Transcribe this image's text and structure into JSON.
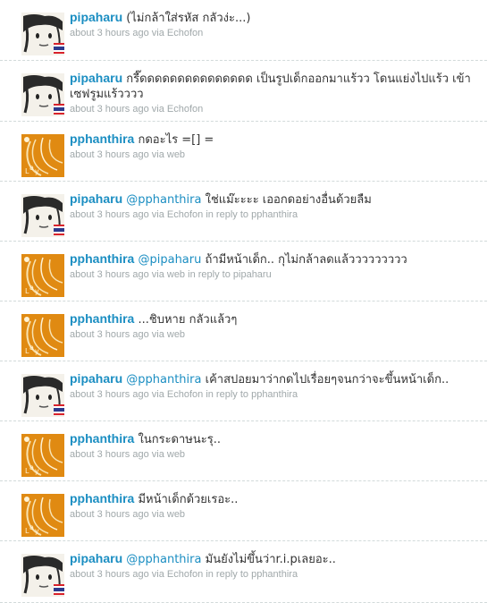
{
  "tweets": [
    {
      "user": "pipaharu",
      "avatar": "pipaharu-avatar",
      "mention": "",
      "text": "(ไม่กล้าใส่รหัส กลัวง่ะ...)",
      "time": "about 3 hours ago",
      "via_prefix": "via",
      "source": "Echofon",
      "reply_prefix": "",
      "reply_to": ""
    },
    {
      "user": "pipaharu",
      "avatar": "pipaharu-avatar",
      "mention": "",
      "text": "กรี๊ดดดดดดดดดดดดดดด เป็นรูปเด็กออกมาแร้วว โดนแย่งไปแร้ว เข้าเซฟรูมแร้วววว",
      "time": "about 3 hours ago",
      "via_prefix": "via",
      "source": "Echofon",
      "reply_prefix": "",
      "reply_to": ""
    },
    {
      "user": "pphanthira",
      "avatar": "pphanthira-avatar",
      "mention": "",
      "text": "กดอะไร =[] =",
      "time": "about 3 hours ago",
      "via_prefix": "via",
      "source": "web",
      "reply_prefix": "",
      "reply_to": ""
    },
    {
      "user": "pipaharu",
      "avatar": "pipaharu-avatar",
      "mention": "@pphanthira",
      "text": "ใช่แม๊ะะะะ เออกดอย่างอื่นด้วยลืม",
      "time": "about 3 hours ago",
      "via_prefix": "via",
      "source": "Echofon",
      "reply_prefix": "in reply to",
      "reply_to": "pphanthira"
    },
    {
      "user": "pphanthira",
      "avatar": "pphanthira-avatar",
      "mention": "@pipaharu",
      "text": "ถ้ามีหน้าเด็ก.. กุไม่กล้าลดแล้ววววววววว",
      "time": "about 3 hours ago",
      "via_prefix": "via",
      "source": "web",
      "reply_prefix": "in reply to",
      "reply_to": "pipaharu"
    },
    {
      "user": "pphanthira",
      "avatar": "pphanthira-avatar",
      "mention": "",
      "text": "...ชิบหาย กลัวแล้วๆ",
      "time": "about 3 hours ago",
      "via_prefix": "via",
      "source": "web",
      "reply_prefix": "",
      "reply_to": ""
    },
    {
      "user": "pipaharu",
      "avatar": "pipaharu-avatar",
      "mention": "@pphanthira",
      "text": "เค้าสปอยมาว่ากดไปเรื่อยๆจนกว่าจะขึ้นหน้าเด็ก..",
      "time": "about 3 hours ago",
      "via_prefix": "via",
      "source": "Echofon",
      "reply_prefix": "in reply to",
      "reply_to": "pphanthira"
    },
    {
      "user": "pphanthira",
      "avatar": "pphanthira-avatar",
      "mention": "",
      "text": "ในกระดาษนะรุ..",
      "time": "about 3 hours ago",
      "via_prefix": "via",
      "source": "web",
      "reply_prefix": "",
      "reply_to": ""
    },
    {
      "user": "pphanthira",
      "avatar": "pphanthira-avatar",
      "mention": "",
      "text": "มีหน้าเด็กด้วยเรอะ..",
      "time": "about 3 hours ago",
      "via_prefix": "via",
      "source": "web",
      "reply_prefix": "",
      "reply_to": ""
    },
    {
      "user": "pipaharu",
      "avatar": "pipaharu-avatar",
      "mention": "@pphanthira",
      "text": "มันยังไม่ขึ้นว่าr.i.pเลยอะ..",
      "time": "about 3 hours ago",
      "via_prefix": "via",
      "source": "Echofon",
      "reply_prefix": "in reply to",
      "reply_to": "pphanthira"
    }
  ],
  "colors": {
    "link": "#1b8ec2",
    "text": "#333333",
    "meta": "#a0a8aa",
    "divider": "#d2dada",
    "orange": "#e08a12"
  }
}
